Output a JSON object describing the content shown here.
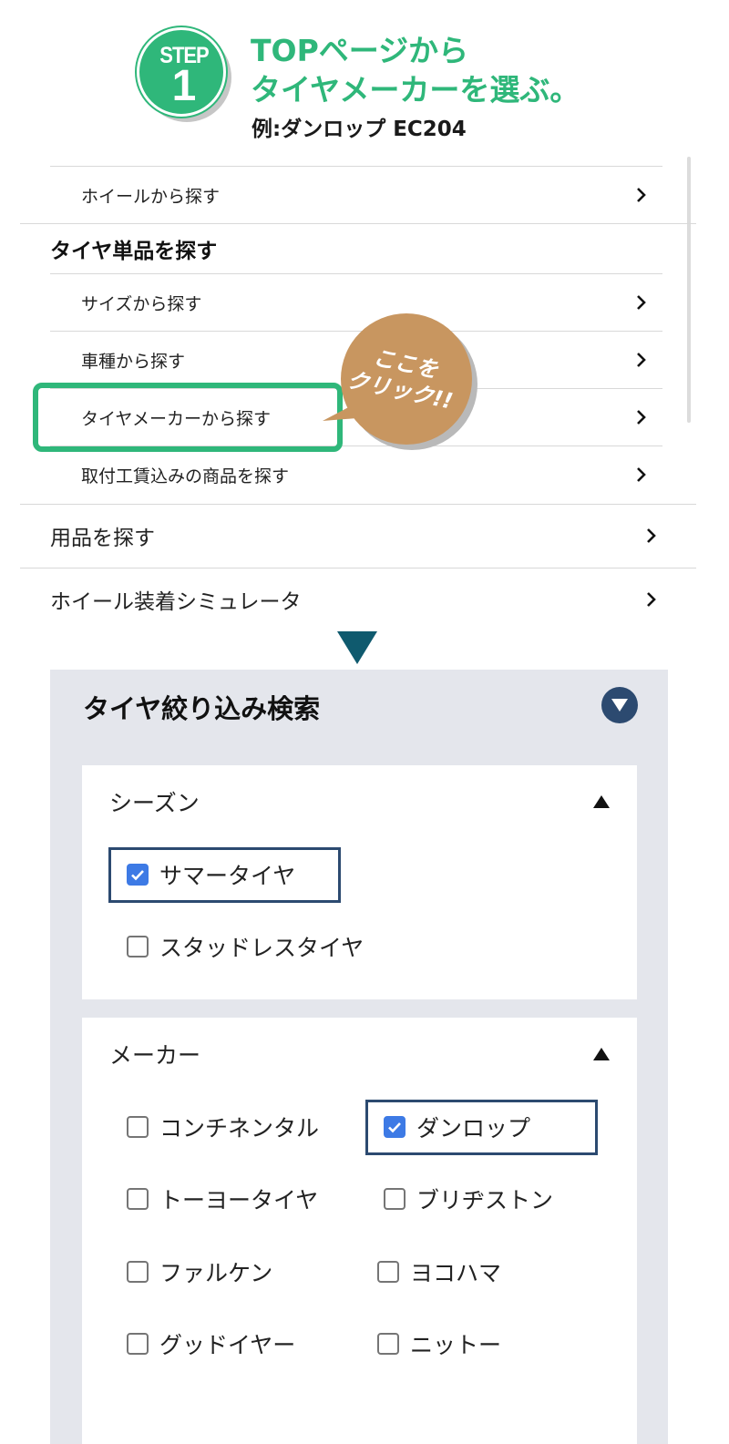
{
  "step": {
    "word": "STEP",
    "number": "1",
    "title": "TOPページから\nタイヤメーカーを選ぶ。",
    "example": "例:ダンロップ EC204"
  },
  "menu": {
    "wheel_search": "ホイールから探す",
    "tire_section_title": "タイヤ単品を探す",
    "size_search": "サイズから探す",
    "car_search": "車種から探す",
    "maker_search": "タイヤメーカーから探す",
    "install_search": "取付工賃込みの商品を探す",
    "supplies": "用品を探す",
    "wheel_simulator": "ホイール装着シミュレータ"
  },
  "callout": {
    "text": "ここを\nクリック!!",
    "color": "#c89660"
  },
  "filter": {
    "title": "タイヤ絞り込み検索",
    "season": {
      "title": "シーズン",
      "options": [
        {
          "label": "サマータイヤ",
          "checked": true
        },
        {
          "label": "スタッドレスタイヤ",
          "checked": false
        }
      ]
    },
    "maker": {
      "title": "メーカー",
      "options": [
        {
          "label": "コンチネンタル",
          "checked": false
        },
        {
          "label": "ダンロップ",
          "checked": true
        },
        {
          "label": "トーヨータイヤ",
          "checked": false
        },
        {
          "label": "ブリヂストン",
          "checked": false
        },
        {
          "label": "ファルケン",
          "checked": false
        },
        {
          "label": "ヨコハマ",
          "checked": false
        },
        {
          "label": "グッドイヤー",
          "checked": false
        },
        {
          "label": "ニットー",
          "checked": false
        }
      ]
    }
  },
  "colors": {
    "accent_green": "#2fb77a",
    "navy": "#2c4a70",
    "checkbox_blue": "#3d7ae5",
    "panel_bg": "#e4e6ec"
  }
}
